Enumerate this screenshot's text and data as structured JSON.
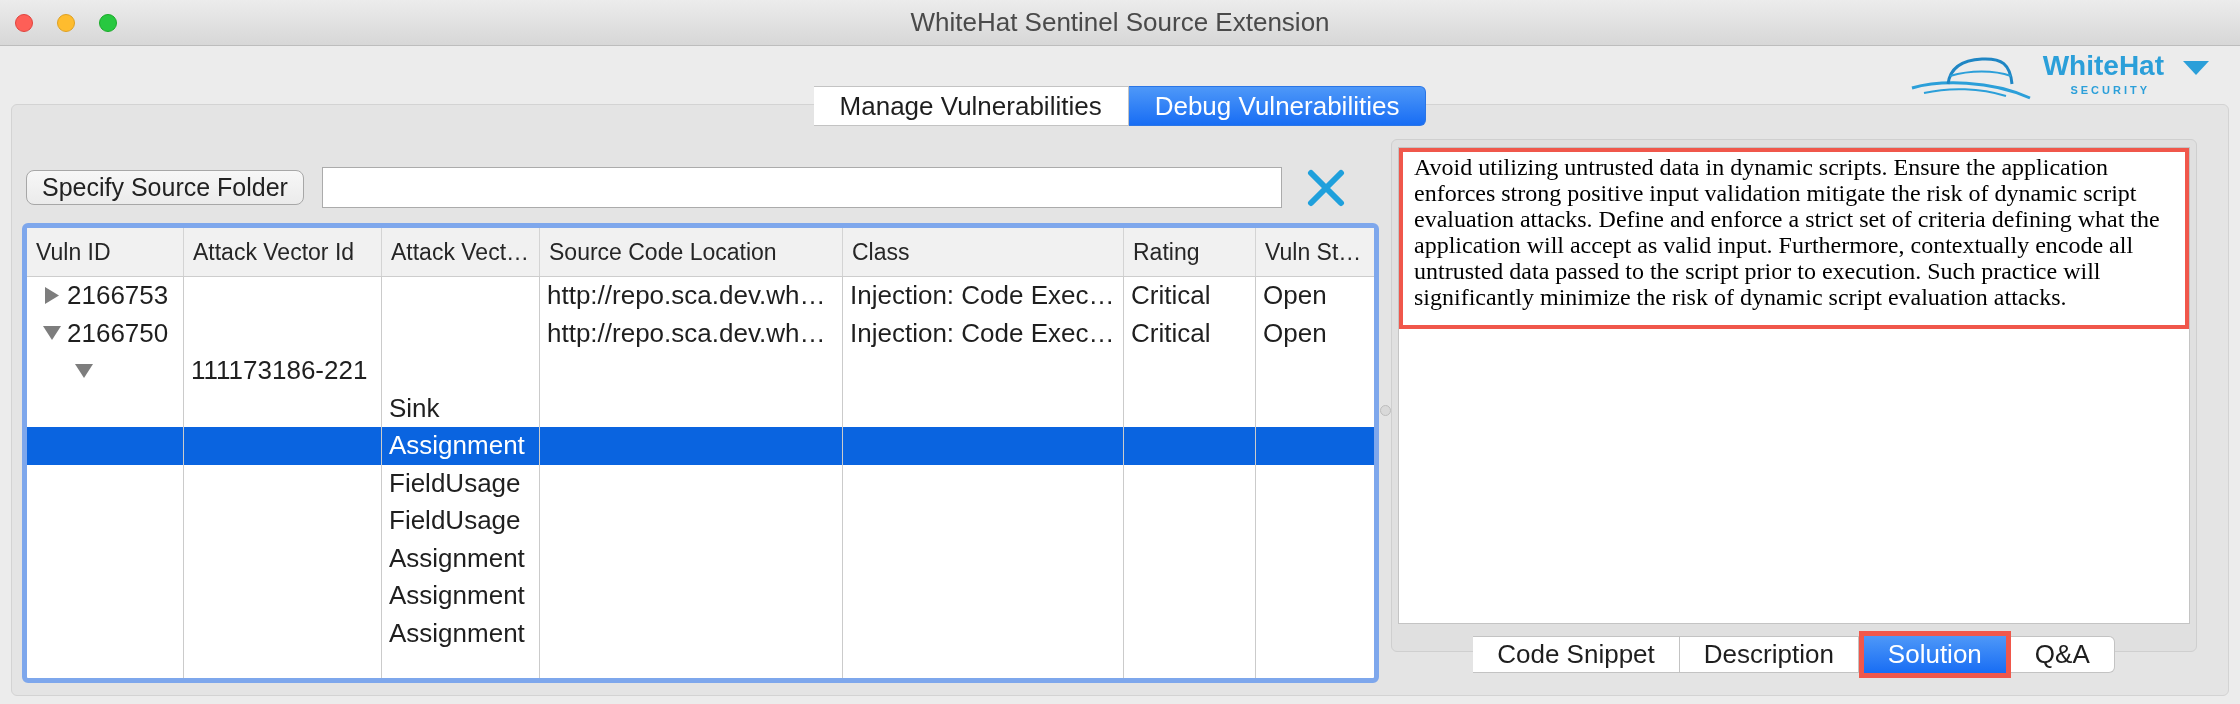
{
  "window": {
    "title": "WhiteHat Sentinel Source Extension"
  },
  "logo": {
    "name": "WhiteHat",
    "tagline": "SECURITY"
  },
  "tabs": [
    {
      "label": "Manage Vulnerabilities",
      "selected": false
    },
    {
      "label": "Debug Vulnerabilities",
      "selected": true
    }
  ],
  "source_folder": {
    "button": "Specify Source Folder"
  },
  "table": {
    "columns": [
      "Vuln ID",
      "Attack Vector Id",
      "Attack Vect…",
      "Source Code Location",
      "Class",
      "Rating",
      "Vuln St…"
    ],
    "rows": [
      {
        "vuln_id": "2166753",
        "expanded": false,
        "selected": false,
        "source_code_location": "http://repo.sca.dev.wh…",
        "class": "Injection: Code Exec…",
        "rating": "Critical",
        "column_7": "Open"
      },
      {
        "vuln_id": "2166750",
        "expanded": true,
        "selected": false,
        "source_code_location": "http://repo.sca.dev.wh…",
        "class": "Injection: Code Exec…",
        "rating": "Critical",
        "column_7": "Open",
        "children": [
          {
            "attack_vector_id": "111173186-221",
            "expanded": true,
            "selected": false,
            "children": [
              {
                "column_3": "Sink",
                "selected": false
              },
              {
                "column_3": "Assignment",
                "selected": true
              },
              {
                "column_3": "FieldUsage",
                "selected": false
              },
              {
                "column_3": "FieldUsage",
                "selected": false
              },
              {
                "column_3": "Assignment",
                "selected": false
              },
              {
                "column_3": "Assignment",
                "selected": false
              },
              {
                "column_3": "Assignment",
                "selected": false
              }
            ]
          }
        ]
      }
    ]
  },
  "detail": {
    "text": "Avoid utilizing untrusted data in dynamic scripts. Ensure the application enforces strong positive input validation mitigate the risk of dynamic script evaluation attacks. Define and enforce a strict set of criteria defining what the application will accept as valid input. Furthermore, contextually encode all untrusted data passed to the script prior to execution. Such practice will significantly minimize the risk of dynamic script evaluation attacks.",
    "highlighted": true
  },
  "detail_tabs": [
    {
      "label": "Code Snippet",
      "selected": false,
      "highlighted": false
    },
    {
      "label": "Description",
      "selected": false,
      "highlighted": false
    },
    {
      "label": "Solution",
      "selected": true,
      "highlighted": true
    },
    {
      "label": "Q&A",
      "selected": false,
      "highlighted": false
    }
  ]
}
